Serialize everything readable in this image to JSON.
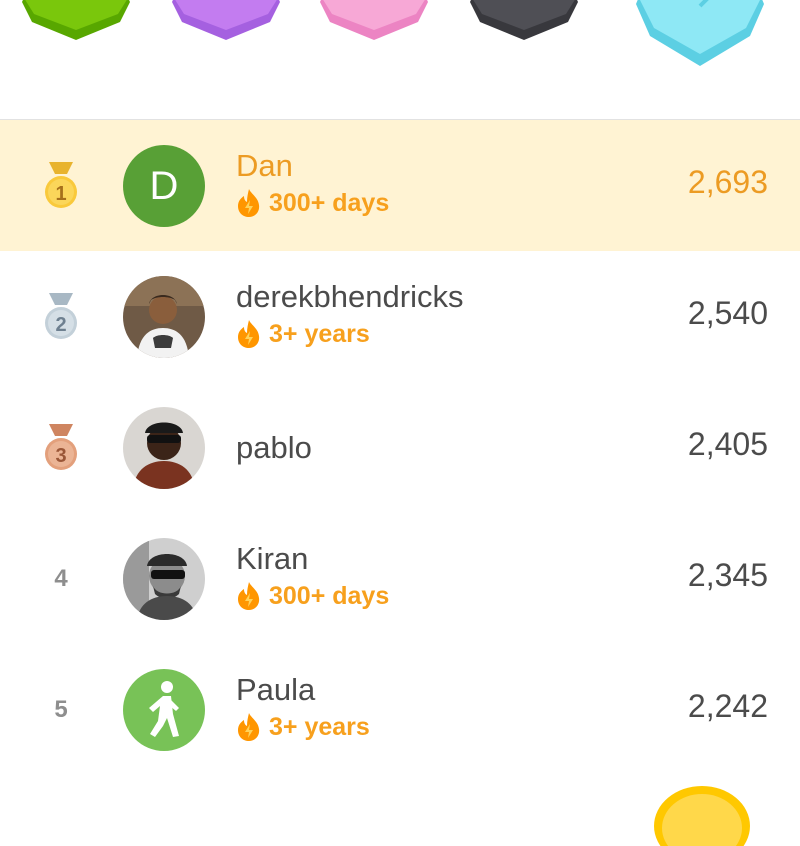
{
  "league_badges": [
    {
      "name": "green-league-badge",
      "color": "#7ac70c",
      "shade": "#58a700"
    },
    {
      "name": "purple-league-badge",
      "color": "#c37cf0",
      "shade": "#a560e0"
    },
    {
      "name": "pink-league-badge",
      "color": "#f7a8d6",
      "shade": "#ec84c3"
    },
    {
      "name": "black-league-badge",
      "color": "#4f4f55",
      "shade": "#38383d"
    },
    {
      "name": "diamond-league-badge",
      "color": "#8ee8f5",
      "shade": "#5ccfe3"
    }
  ],
  "leaderboard": [
    {
      "rank": "1",
      "medal": "gold",
      "name": "Dan",
      "avatar": "letter-D",
      "avatar_letter": "D",
      "streak": "300+ days",
      "xp": "2,693",
      "current": true
    },
    {
      "rank": "2",
      "medal": "silver",
      "name": "derekbhendricks",
      "avatar": "photo",
      "streak": "3+ years",
      "xp": "2,540"
    },
    {
      "rank": "3",
      "medal": "bronze",
      "name": "pablo",
      "avatar": "photo",
      "streak": "",
      "xp": "2,405"
    },
    {
      "rank": "4",
      "medal": "",
      "name": "Kiran",
      "avatar": "photo",
      "streak": "300+ days",
      "xp": "2,345"
    },
    {
      "rank": "5",
      "medal": "",
      "name": "Paula",
      "avatar": "walker-icon",
      "streak": "3+ years",
      "xp": "2,242"
    }
  ],
  "colors": {
    "highlight_row": "#fff3d3",
    "accent_orange": "#ec9b23",
    "streak_orange": "#f7a01d",
    "gold": "#f9c93b",
    "silver": "#c3d0d9",
    "bronze": "#e3a07c",
    "avatar_green": "#58a036",
    "avatar_light_green": "#78c257"
  }
}
